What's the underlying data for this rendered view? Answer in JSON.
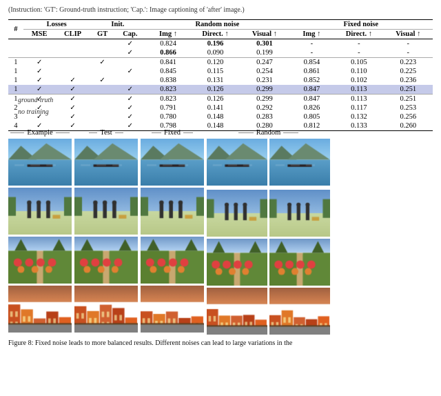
{
  "caption_top": "(Instruction: 'GT': Ground-truth instruction; 'Cap.': Image captioning of 'after' image.)",
  "table": {
    "col_groups": [
      {
        "label": "Losses",
        "colspan": 2
      },
      {
        "label": "Init.",
        "colspan": 2
      },
      {
        "label": "Random noise",
        "colspan": 3
      },
      {
        "label": "Fixed noise",
        "colspan": 3
      }
    ],
    "headers": [
      "#",
      "MSE",
      "CLIP",
      "GT",
      "Cap.",
      "Img ↑",
      "Direct. ↑",
      "Visual ↑",
      "Img ↑",
      "Direct. ↑",
      "Visual ↑"
    ],
    "rows": [
      {
        "id": "",
        "mse": "",
        "clip": "",
        "gt": "",
        "cap": "✓",
        "r_img": "0.824",
        "r_dir": "0.196",
        "r_vis": "0.301",
        "f_img": "-",
        "f_dir": "-",
        "f_vis": "-",
        "label": "ground-truth",
        "bold_cols": [
          5,
          6
        ],
        "group": "baseline"
      },
      {
        "id": "",
        "mse": "",
        "clip": "",
        "gt": "",
        "cap": "✓",
        "r_img": "0.866",
        "r_dir": "0.090",
        "r_vis": "0.199",
        "f_img": "-",
        "f_dir": "-",
        "f_vis": "-",
        "label": "no training",
        "bold_cols": [
          4
        ],
        "group": "baseline"
      },
      {
        "id": "1",
        "mse": "✓",
        "clip": "",
        "gt": "✓",
        "cap": "",
        "r_img": "0.841",
        "r_dir": "0.120",
        "r_vis": "0.247",
        "f_img": "0.854",
        "f_dir": "0.105",
        "f_vis": "0.223",
        "group": "A"
      },
      {
        "id": "1",
        "mse": "✓",
        "clip": "",
        "gt": "",
        "cap": "✓",
        "r_img": "0.845",
        "r_dir": "0.115",
        "r_vis": "0.254",
        "f_img": "0.861",
        "f_dir": "0.110",
        "f_vis": "0.225",
        "group": "A"
      },
      {
        "id": "1",
        "mse": "✓",
        "clip": "✓",
        "gt": "✓",
        "cap": "",
        "r_img": "0.838",
        "r_dir": "0.131",
        "r_vis": "0.231",
        "f_img": "0.852",
        "f_dir": "0.102",
        "f_vis": "0.236",
        "group": "A"
      },
      {
        "id": "1",
        "mse": "✓",
        "clip": "✓",
        "gt": "",
        "cap": "✓",
        "r_img": "0.823",
        "r_dir": "0.126",
        "r_vis": "0.299",
        "f_img": "0.847",
        "f_dir": "0.113",
        "f_vis": "0.251",
        "group": "A",
        "highlight_f_img": true
      },
      {
        "id": "1",
        "mse": "✓",
        "clip": "✓",
        "gt": "",
        "cap": "✓",
        "r_img": "0.823",
        "r_dir": "0.126",
        "r_vis": "0.299",
        "f_img": "0.847",
        "f_dir": "0.113",
        "f_vis": "0.251",
        "group": "B"
      },
      {
        "id": "2",
        "mse": "✓",
        "clip": "✓",
        "gt": "",
        "cap": "✓",
        "r_img": "0.791",
        "r_dir": "0.141",
        "r_vis": "0.292",
        "f_img": "0.826",
        "f_dir": "0.117",
        "f_vis": "0.253",
        "group": "B"
      },
      {
        "id": "3",
        "mse": "✓",
        "clip": "✓",
        "gt": "",
        "cap": "✓",
        "r_img": "0.780",
        "r_dir": "0.148",
        "r_vis": "0.283",
        "f_img": "0.805",
        "f_dir": "0.132",
        "f_vis": "0.256",
        "group": "B"
      },
      {
        "id": "4",
        "mse": "✓",
        "clip": "✓",
        "gt": "",
        "cap": "✓",
        "r_img": "0.798",
        "r_dir": "0.148",
        "r_vis": "0.280",
        "f_img": "0.812",
        "f_dir": "0.133",
        "f_vis": "0.260",
        "group": "B"
      }
    ]
  },
  "image_section": {
    "labels": {
      "example": "Example",
      "test": "Test",
      "fixed": "Fixed",
      "random": "Random"
    },
    "rows": [
      {
        "theme": "lake",
        "desc": "Lakeside scene"
      },
      {
        "theme": "people",
        "desc": "People outdoors"
      },
      {
        "theme": "garden",
        "desc": "Garden/nature"
      },
      {
        "theme": "street",
        "desc": "Colorful street"
      }
    ]
  },
  "figure_caption": "Figure 8: Fixed noise leads to more balanced results. Different noises can lead to large variations in the"
}
